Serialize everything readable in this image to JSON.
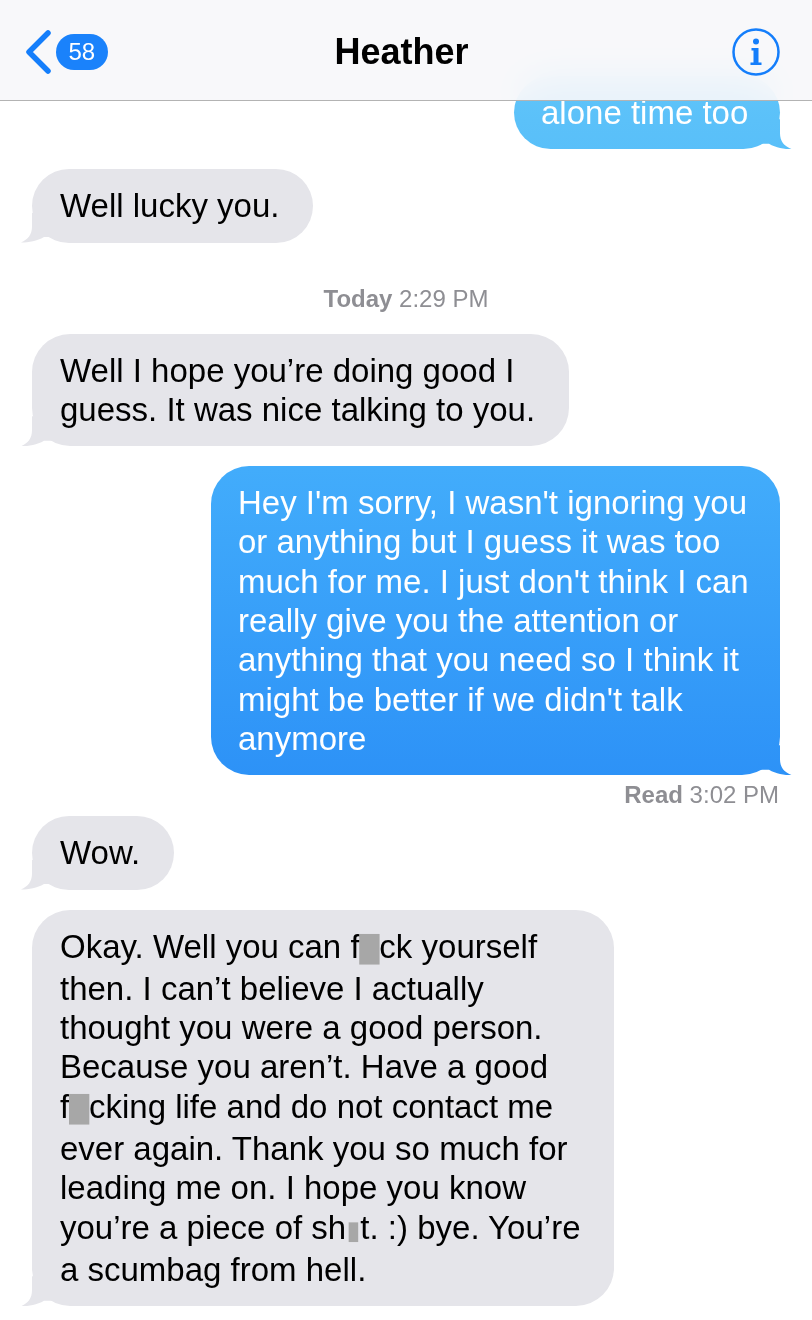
{
  "nav_bar": {
    "unread_count": "58",
    "title": "Heather"
  },
  "conversation": [
    {
      "kind": "sent",
      "text": "alone time too"
    },
    {
      "kind": "received",
      "text": "Well lucky you."
    },
    {
      "kind": "timestamp",
      "text": "**Today** 2:29 PM"
    },
    {
      "kind": "received",
      "text": "Well I hope you’re doing good I guess. It was nice talking to you."
    },
    {
      "kind": "sent",
      "text": "Hey I'm sorry, I wasn't ignoring you or anything but I guess it was too much for me. I just don't think I can really give you the attention or anything that you need so I think it might be better if we didn't talk anymore"
    },
    {
      "kind": "receipt",
      "text": "**Read** 3:02 PM"
    },
    {
      "kind": "received",
      "text": "Wow."
    },
    {
      "kind": "received",
      "segments": [
        {
          "kind": "text",
          "text": "Okay. Well you can f"
        },
        {
          "kind": "redacted",
          "text": "█"
        },
        {
          "kind": "text",
          "text": "ck yourself then. I can’t believe I actually thought you were a good person. Because you aren’t. Have a good f"
        },
        {
          "kind": "redacted",
          "text": "█"
        },
        {
          "kind": "text",
          "text": "cking life and do not contact me ever again. Thank you so much for leading me on. I hope you know you’re a piece of sh"
        },
        {
          "kind": "redacted",
          "text": "▮"
        },
        {
          "kind": "text",
          "text": "t. :) bye. You’re a scumbag from hell."
        }
      ]
    }
  ]
}
